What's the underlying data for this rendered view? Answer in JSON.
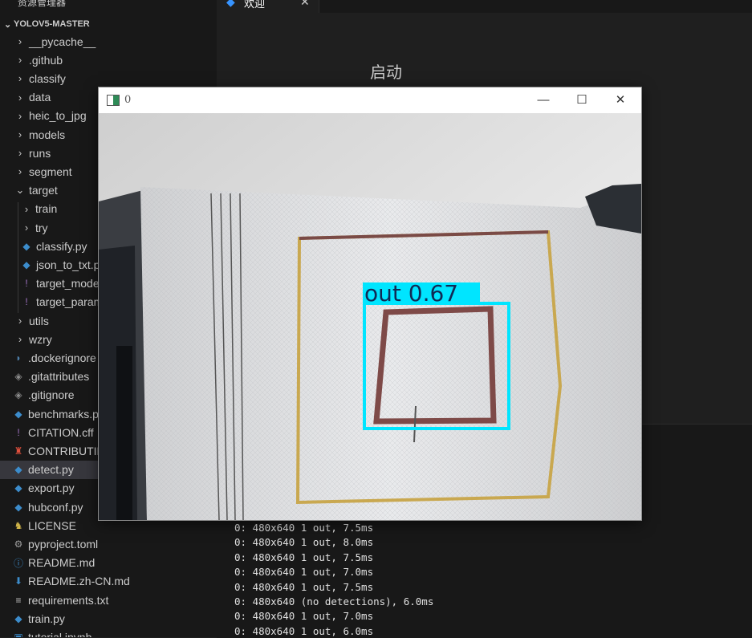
{
  "sidebar": {
    "header_label": "资源管理器",
    "section_title": "YOLOV5-MASTER",
    "items": [
      {
        "label": "__pycache__",
        "kind": "folder"
      },
      {
        "label": ".github",
        "kind": "folder"
      },
      {
        "label": "classify",
        "kind": "folder"
      },
      {
        "label": "data",
        "kind": "folder"
      },
      {
        "label": "heic_to_jpg",
        "kind": "folder"
      },
      {
        "label": "models",
        "kind": "folder"
      },
      {
        "label": "runs",
        "kind": "folder"
      },
      {
        "label": "segment",
        "kind": "folder"
      },
      {
        "label": "target",
        "kind": "folder-open"
      },
      {
        "label": "train",
        "kind": "folder"
      },
      {
        "label": "try",
        "kind": "folder"
      },
      {
        "label": "classify.py",
        "kind": "python"
      },
      {
        "label": "json_to_txt.py",
        "kind": "python"
      },
      {
        "label": "target_model",
        "kind": "yaml"
      },
      {
        "label": "target_param",
        "kind": "yaml"
      },
      {
        "label": "utils",
        "kind": "folder"
      },
      {
        "label": "wzry",
        "kind": "folder"
      },
      {
        "label": ".dockerignore",
        "kind": "docker"
      },
      {
        "label": ".gitattributes",
        "kind": "git"
      },
      {
        "label": ".gitignore",
        "kind": "git"
      },
      {
        "label": "benchmarks.py",
        "kind": "python"
      },
      {
        "label": "CITATION.cff",
        "kind": "yaml"
      },
      {
        "label": "CONTRIBUTING",
        "kind": "contrib"
      },
      {
        "label": "detect.py",
        "kind": "python"
      },
      {
        "label": "export.py",
        "kind": "python"
      },
      {
        "label": "hubconf.py",
        "kind": "python"
      },
      {
        "label": "LICENSE",
        "kind": "license"
      },
      {
        "label": "pyproject.toml",
        "kind": "gear"
      },
      {
        "label": "README.md",
        "kind": "info"
      },
      {
        "label": "README.zh-CN.md",
        "kind": "markdown"
      },
      {
        "label": "requirements.txt",
        "kind": "text"
      },
      {
        "label": "train.py",
        "kind": "python"
      },
      {
        "label": "tutorial.ipynb",
        "kind": "notebook"
      }
    ]
  },
  "editor": {
    "tab_label": "欢迎",
    "content_text": "启动"
  },
  "terminal": {
    "lines": [
      "0: 480x640 1 out, 7.5ms",
      "0: 480x640 1 out, 8.0ms",
      "0: 480x640 1 out, 7.5ms",
      "0: 480x640 1 out, 7.0ms",
      "0: 480x640 1 out, 7.5ms",
      "0: 480x640 (no detections), 6.0ms",
      "0: 480x640 1 out, 7.0ms",
      "0: 480x640 1 out, 6.0ms"
    ]
  },
  "cv_window": {
    "title": "0",
    "minimize_glyph": "—",
    "maximize_glyph": "☐",
    "close_glyph": "✕",
    "detection": {
      "label": "out 0.67",
      "color": "#00e5ff"
    }
  },
  "colors": {
    "sidebar_bg": "#181818",
    "editor_bg": "#1f1f1f",
    "selected_row": "#37373d",
    "python_icon": "#3c8ccb",
    "yaml_icon": "#a074c4",
    "accent": "#3794ff"
  }
}
